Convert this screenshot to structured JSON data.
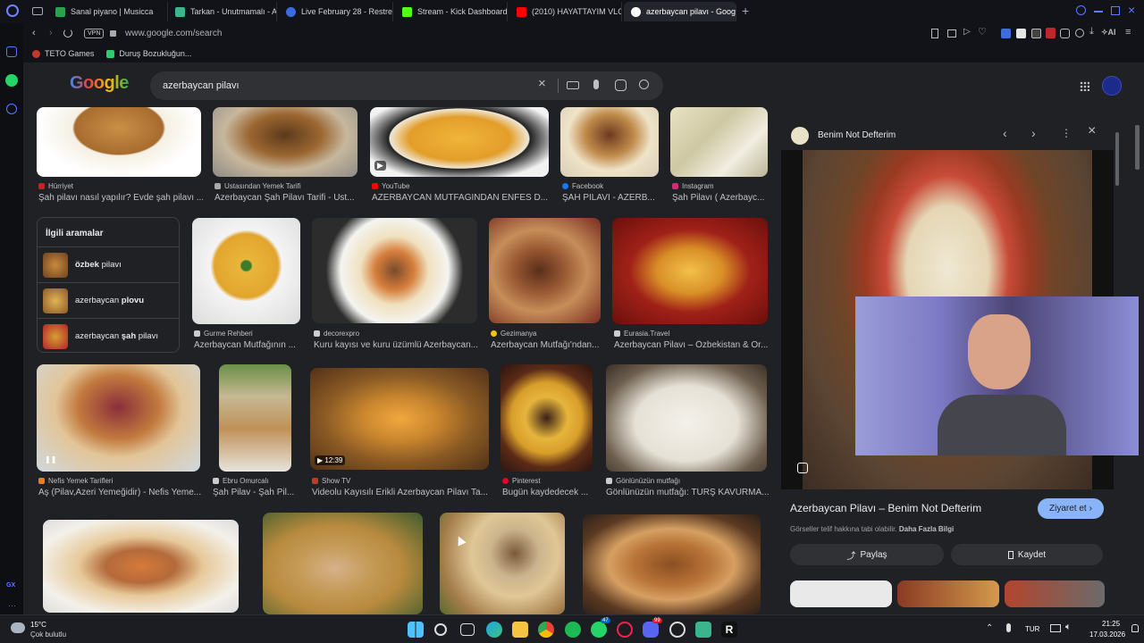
{
  "tabs": [
    {
      "label": "Sanal piyano | Musicca",
      "color": "#2aa14a"
    },
    {
      "label": "Tarkan - Unutmamalı - Ak",
      "color": "#3bb58c"
    },
    {
      "label": "Live February 28 - Restrea",
      "color": "#3b6be0"
    },
    {
      "label": "Stream - Kick Dashboard",
      "color": "#53fc18"
    },
    {
      "label": "(2010) HAYATTAYIM VLOG",
      "color": "#ff0000"
    },
    {
      "label": "azerbaycan pilavı - Google",
      "color": "#ffffff"
    }
  ],
  "address": {
    "vpn": "VPN",
    "url": "www.google.com/search",
    "ai": "AI"
  },
  "bookmarks": [
    "TETO Games",
    "Duruş Bozukluğun..."
  ],
  "search": {
    "query": "azerbaycan pilavı",
    "logo": "Google"
  },
  "related": {
    "heading": "İlgili aramalar",
    "items": [
      {
        "bold": "özbek",
        "rest": " pilavı"
      },
      {
        "bold": "",
        "rest": "azerbaycan ",
        "bold2": "plovu"
      },
      {
        "bold": "",
        "rest": "azerbaycan ",
        "bold2": "şah",
        "rest2": " pilavı"
      }
    ]
  },
  "results_row1": [
    {
      "source": "Hürriyet",
      "title": "Şah pilavı nasıl yapılır? Evde şah pilavı ..."
    },
    {
      "source": "Ustasından Yemek Tarifi",
      "title": "Azerbaycan Şah Pilavı Tarifi - Ust..."
    },
    {
      "source": "YouTube",
      "title": "AZERBAYCAN MUTFAĞINDAN ENFES D..."
    },
    {
      "source": "Facebook",
      "title": "ŞAH PİLAVI - AZERB..."
    },
    {
      "source": "Instagram",
      "title": "Şah Pilavı ( Azerbayc..."
    }
  ],
  "results_row2": [
    {
      "source": "Gurme Rehberi",
      "title": "Azerbaycan Mutfağının ..."
    },
    {
      "source": "decorexpro",
      "title": "Kuru kayısı ve kuru üzümlü Azerbaycan..."
    },
    {
      "source": "Gezimanya",
      "title": "Azerbaycan Mutfağı'ndan..."
    },
    {
      "source": "Eurasia.Travel",
      "title": "Azerbaycan Pilavı – Özbekistan & Or..."
    }
  ],
  "results_row3": [
    {
      "source": "Nefis Yemek Tarifleri",
      "title": "Aş (Pilav,Azeri Yemeğidir) - Nefis Yeme..."
    },
    {
      "source": "Ebru Omurcalı",
      "title": "Şah Pilav - Şah Pil..."
    },
    {
      "source": "Show TV",
      "title": "Videolu Kayısılı Erikli Azerbaycan Pilavı Ta...",
      "duration": "12:39"
    },
    {
      "source": "Pinterest",
      "title": "Bugün kaydedecek ..."
    },
    {
      "source": "Gönlünüzün mutfağı",
      "title": "Gönlünüzün mutfağı: TURŞ KAVURMA..."
    }
  ],
  "panel": {
    "site": "Benim Not Defterim",
    "title": "Azerbaycan Pilavı – Benim Not Defterim",
    "visit": "Ziyaret et",
    "copyright": "Görseller telif hakkına tabi olabilir.",
    "more_info": "Daha Fazla Bilgi",
    "share": "Paylaş",
    "save": "Kaydet"
  },
  "left_rail": {
    "gx": "GX"
  },
  "taskbar": {
    "temp": "15°C",
    "weather": "Çok bulutlu",
    "lang": "TUR",
    "time": "21:25",
    "date": "17.03.2026",
    "badge1": "47",
    "badge2": "99"
  }
}
